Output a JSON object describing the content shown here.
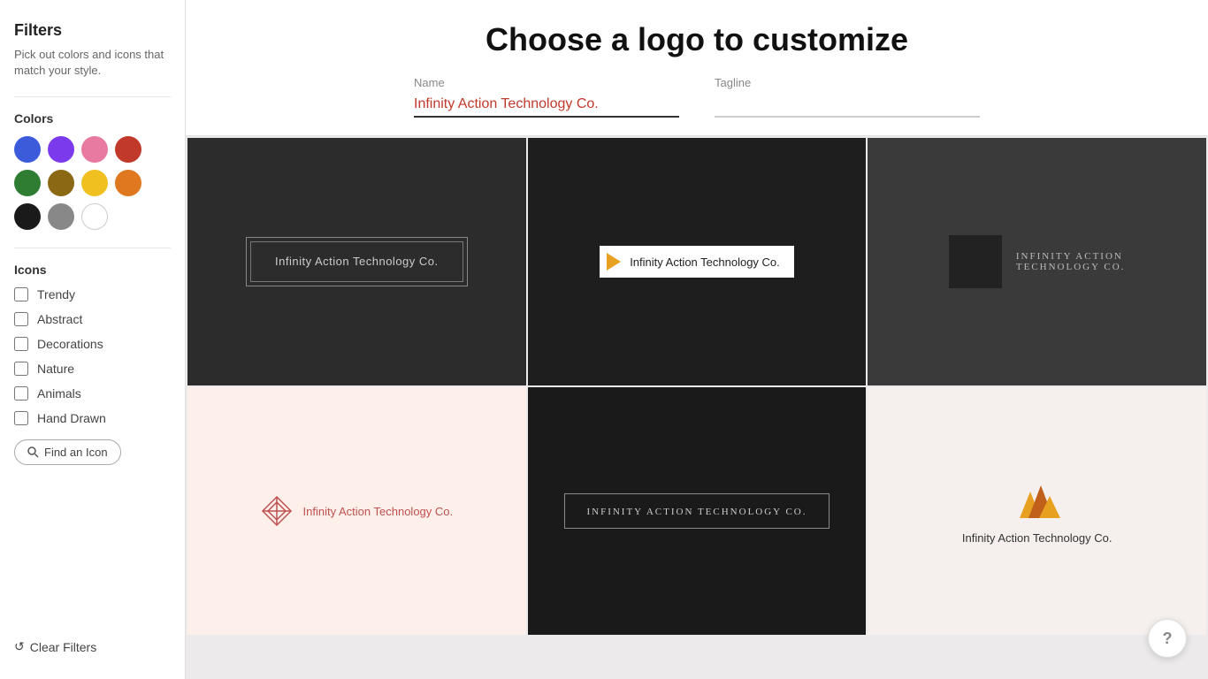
{
  "sidebar": {
    "title": "Filters",
    "subtitle": "Pick out colors and icons that match your style.",
    "colors_label": "Colors",
    "colors": [
      {
        "name": "blue",
        "hex": "#3b5bdb"
      },
      {
        "name": "purple",
        "hex": "#7c3aed"
      },
      {
        "name": "pink",
        "hex": "#e879a0"
      },
      {
        "name": "red",
        "hex": "#c0392b"
      },
      {
        "name": "green",
        "hex": "#2e7d32"
      },
      {
        "name": "brown",
        "hex": "#8b6914"
      },
      {
        "name": "yellow",
        "hex": "#f0c020"
      },
      {
        "name": "orange",
        "hex": "#e07820"
      },
      {
        "name": "black",
        "hex": "#1a1a1a"
      },
      {
        "name": "gray",
        "hex": "#888888"
      },
      {
        "name": "white",
        "hex": "#ffffff"
      }
    ],
    "icons_label": "Icons",
    "icon_filters": [
      {
        "id": "trendy",
        "label": "Trendy"
      },
      {
        "id": "abstract",
        "label": "Abstract"
      },
      {
        "id": "decorations",
        "label": "Decorations"
      },
      {
        "id": "nature",
        "label": "Nature"
      },
      {
        "id": "animals",
        "label": "Animals"
      },
      {
        "id": "hand-drawn",
        "label": "Hand Drawn"
      }
    ],
    "find_icon_label": "Find an Icon",
    "clear_filters_label": "Clear Filters"
  },
  "main": {
    "page_title": "Choose a logo to customize",
    "name_label": "Name",
    "name_value": "Infinity Action Technology Co.",
    "tagline_label": "Tagline",
    "tagline_value": ""
  },
  "logos": [
    {
      "id": 1,
      "bg": "#2c2c2c",
      "type": "double-border"
    },
    {
      "id": 2,
      "bg": "#1e1e1e",
      "type": "play-icon"
    },
    {
      "id": 3,
      "bg": "#3a3a3a",
      "type": "dark-box-serif"
    },
    {
      "id": 4,
      "bg": "#fdf0eb",
      "type": "diamond-pink"
    },
    {
      "id": 5,
      "bg": "#1a1a1a",
      "type": "border-box-serif"
    },
    {
      "id": 6,
      "bg": "#f5f0ed",
      "type": "flame-orange"
    }
  ],
  "company_name": "Infinity Action Technology Co.",
  "help_label": "?"
}
